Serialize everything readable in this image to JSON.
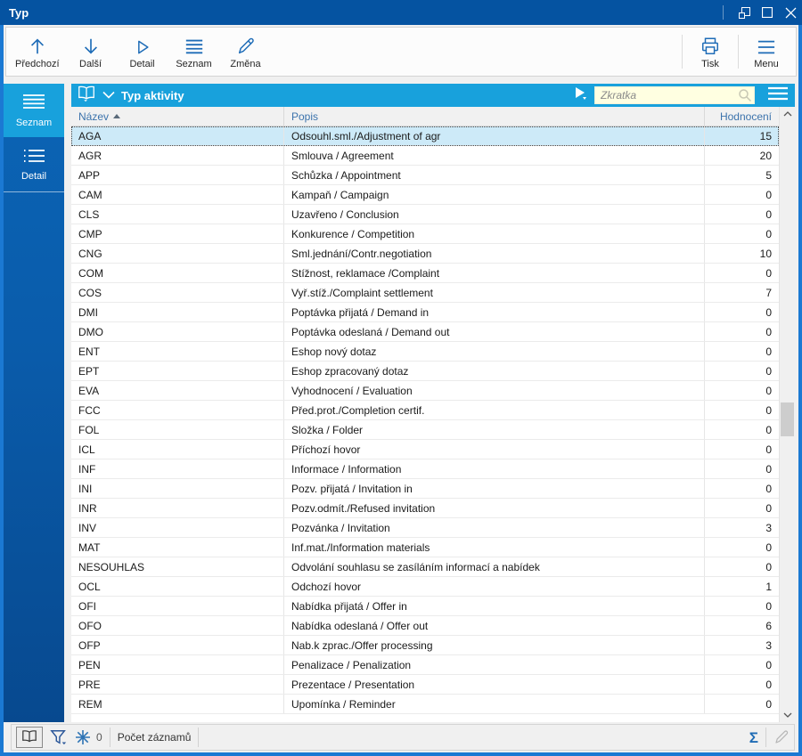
{
  "window": {
    "title": "Typ"
  },
  "toolbar": {
    "buttons": [
      {
        "label": "Předchozí",
        "icon": "arrow-up-icon"
      },
      {
        "label": "Další",
        "icon": "arrow-down-icon"
      },
      {
        "label": "Detail",
        "icon": "triangle-right-icon"
      },
      {
        "label": "Seznam",
        "icon": "list-lines-icon"
      },
      {
        "label": "Změna",
        "icon": "pencil-icon"
      }
    ],
    "right_buttons": [
      {
        "label": "Tisk",
        "icon": "printer-icon"
      },
      {
        "label": "Menu",
        "icon": "menu-lines-icon"
      }
    ]
  },
  "sidebar": {
    "items": [
      {
        "label": "Seznam",
        "active": true
      },
      {
        "label": "Detail",
        "active": false
      }
    ]
  },
  "panel": {
    "title": "Typ aktivity",
    "search_placeholder": "Zkratka"
  },
  "table": {
    "columns": [
      {
        "label": "Název",
        "sort": "asc"
      },
      {
        "label": "Popis"
      },
      {
        "label": "Hodnocení",
        "align": "right"
      }
    ],
    "selected_index": 0,
    "rows": [
      {
        "code": "AGA",
        "desc": "Odsouhl.sml./Adjustment of agr",
        "value": "15"
      },
      {
        "code": "AGR",
        "desc": "Smlouva / Agreement",
        "value": "20"
      },
      {
        "code": "APP",
        "desc": "Schůzka / Appointment",
        "value": "5"
      },
      {
        "code": "CAM",
        "desc": "Kampaň / Campaign",
        "value": "0"
      },
      {
        "code": "CLS",
        "desc": "Uzavřeno / Conclusion",
        "value": "0"
      },
      {
        "code": "CMP",
        "desc": "Konkurence / Competition",
        "value": "0"
      },
      {
        "code": "CNG",
        "desc": "Sml.jednání/Contr.negotiation",
        "value": "10"
      },
      {
        "code": "COM",
        "desc": "Stížnost, reklamace /Complaint",
        "value": "0"
      },
      {
        "code": "COS",
        "desc": "Vyř.stíž./Complaint settlement",
        "value": "7"
      },
      {
        "code": "DMI",
        "desc": "Poptávka přijatá / Demand in",
        "value": "0"
      },
      {
        "code": "DMO",
        "desc": "Poptávka odeslaná / Demand out",
        "value": "0"
      },
      {
        "code": "ENT",
        "desc": "Eshop nový dotaz",
        "value": "0"
      },
      {
        "code": "EPT",
        "desc": "Eshop zpracovaný dotaz",
        "value": "0"
      },
      {
        "code": "EVA",
        "desc": "Vyhodnocení / Evaluation",
        "value": "0"
      },
      {
        "code": "FCC",
        "desc": "Před.prot./Completion certif.",
        "value": "0"
      },
      {
        "code": "FOL",
        "desc": "Složka / Folder",
        "value": "0"
      },
      {
        "code": "ICL",
        "desc": "Příchozí hovor",
        "value": "0"
      },
      {
        "code": "INF",
        "desc": "Informace / Information",
        "value": "0"
      },
      {
        "code": "INI",
        "desc": "Pozv. přijatá / Invitation in",
        "value": "0"
      },
      {
        "code": "INR",
        "desc": "Pozv.odmít./Refused invitation",
        "value": "0"
      },
      {
        "code": "INV",
        "desc": "Pozvánka / Invitation",
        "value": "3"
      },
      {
        "code": "MAT",
        "desc": "Inf.mat./Information materials",
        "value": "0"
      },
      {
        "code": "NESOUHLAS",
        "desc": "Odvolání souhlasu se zasíláním informací a nabídek",
        "value": "0"
      },
      {
        "code": "OCL",
        "desc": "Odchozí hovor",
        "value": "1"
      },
      {
        "code": "OFI",
        "desc": "Nabídka přijatá / Offer in",
        "value": "0"
      },
      {
        "code": "OFO",
        "desc": "Nabídka odeslaná / Offer out",
        "value": "6"
      },
      {
        "code": "OFP",
        "desc": "Nab.k zprac./Offer processing",
        "value": "3"
      },
      {
        "code": "PEN",
        "desc": "Penalizace / Penalization",
        "value": "0"
      },
      {
        "code": "PRE",
        "desc": "Prezentace / Presentation",
        "value": "0"
      },
      {
        "code": "REM",
        "desc": "Upomínka / Reminder",
        "value": "0"
      }
    ]
  },
  "statusbar": {
    "filter_count": "0",
    "records_label": "Počet záznamů",
    "sum_symbol": "Σ"
  },
  "colors": {
    "frame": "#1b79d3",
    "titlebar": "#0553a1",
    "accent_cyan": "#18a1dc",
    "sidebar_blue": "#0b64b5",
    "selection": "#cdeaf8",
    "header_text": "#3c73ac",
    "search_bg": "#ffffe1"
  }
}
